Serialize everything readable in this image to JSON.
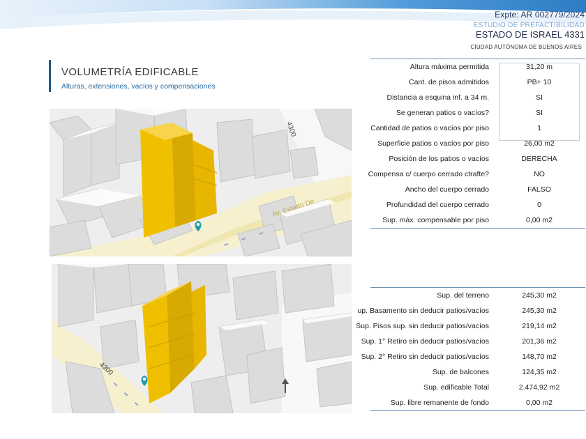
{
  "header": {
    "expediente": "Expte: AR 002779/2024",
    "estudio": "ESTUDIO DE PREFACTIBILIDAD",
    "address": "ESTADO DE ISRAEL 4331",
    "city": "CIUDAD AUTÓNOMA DE BUENOS AIRES"
  },
  "section": {
    "title": "VOLUMETRÍA EDIFICABLE",
    "subtitle": "Alturas, extensiones, vacíos y compensaciones"
  },
  "map_top": {
    "street_number": "4300",
    "street_name": "Av. Estado De"
  },
  "map_bottom": {
    "street_number": "4300"
  },
  "table1": [
    {
      "label": "Altura máxima permitida",
      "value": "31,20 m"
    },
    {
      "label": "Cant. de pisos admitidos",
      "value": "PB+ 10"
    },
    {
      "label": "Distancia a esquina inf. a 34 m.",
      "value": "SI"
    },
    {
      "label": "Se generan patios o vacíos?",
      "value": "SI"
    },
    {
      "label": "Cantidad de patios o vacíos por piso",
      "value": "1"
    },
    {
      "label": "Superficie patios o vacíos por piso",
      "value": "26,00 m2"
    },
    {
      "label": "Posición de los patios o vacíos",
      "value": "DERECHA"
    },
    {
      "label": "Compensa c/ cuerpo cerrado ctrafte?",
      "value": "NO"
    },
    {
      "label": "Ancho del cuerpo cerrado",
      "value": "FALSO"
    },
    {
      "label": "Profundidad del cuerpo cerrado",
      "value": "0"
    },
    {
      "label": "Sup. máx. compensable por piso",
      "value": "0,00 m2"
    }
  ],
  "table2": [
    {
      "label": "Sup. del terreno",
      "value": "245,30 m2"
    },
    {
      "label": "up. Basamento sin deducir patios/vacíos",
      "value": "245,30 m2"
    },
    {
      "label": "Sup. Pisos sup. sin deducir patios/vacíos",
      "value": "219,14 m2"
    },
    {
      "label": "Sup. 1° Retiro sin deducir patios/vacíos",
      "value": "201,36 m2"
    },
    {
      "label": "Sup. 2° Retiro sin deducir patios/vacíos",
      "value": "148,70 m2"
    },
    {
      "label": "Sup. de balcones",
      "value": "124,35 m2"
    },
    {
      "label": "Sup. edificable Total",
      "value": "2.474,92 m2"
    },
    {
      "label": "Sup. libre remanente de fondo",
      "value": "0,00 m2"
    }
  ],
  "colors": {
    "accent_blue": "#1f5a8a",
    "band_blue": "#3f8fd4",
    "volume_yellow": "#f0c000",
    "pin_teal": "#1f9aa8"
  }
}
